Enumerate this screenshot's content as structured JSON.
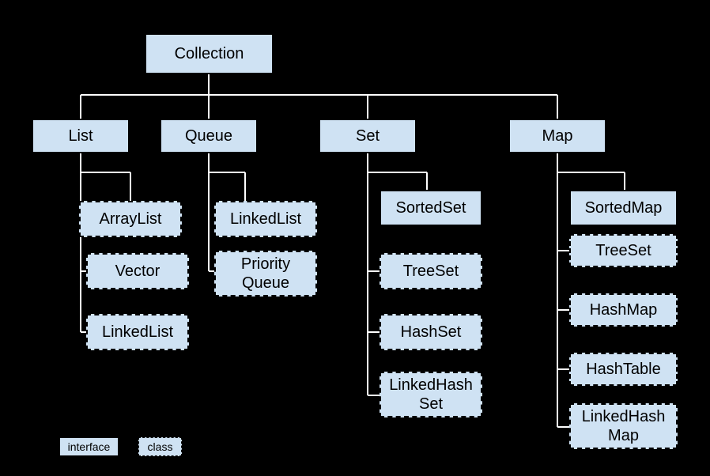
{
  "root": {
    "label": "Collection"
  },
  "branches": {
    "list": {
      "label": "List"
    },
    "queue": {
      "label": "Queue"
    },
    "set": {
      "label": "Set"
    },
    "map": {
      "label": "Map"
    }
  },
  "list_children": {
    "arraylist": "ArrayList",
    "vector": "Vector",
    "linkedlist": "LinkedList"
  },
  "queue_children": {
    "linkedlist": "LinkedList",
    "priorityqueue": "Priority\nQueue"
  },
  "set_children": {
    "sortedset": "SortedSet",
    "treeset": "TreeSet",
    "hashset": "HashSet",
    "linkedhashset": "LinkedHash\nSet"
  },
  "map_children": {
    "sortedmap": "SortedMap",
    "treeset": "TreeSet",
    "hashmap": "HashMap",
    "hashtable": "HashTable",
    "linkedhashmap": "LinkedHash\nMap"
  },
  "legend": {
    "interface": "interface",
    "class": "class"
  }
}
